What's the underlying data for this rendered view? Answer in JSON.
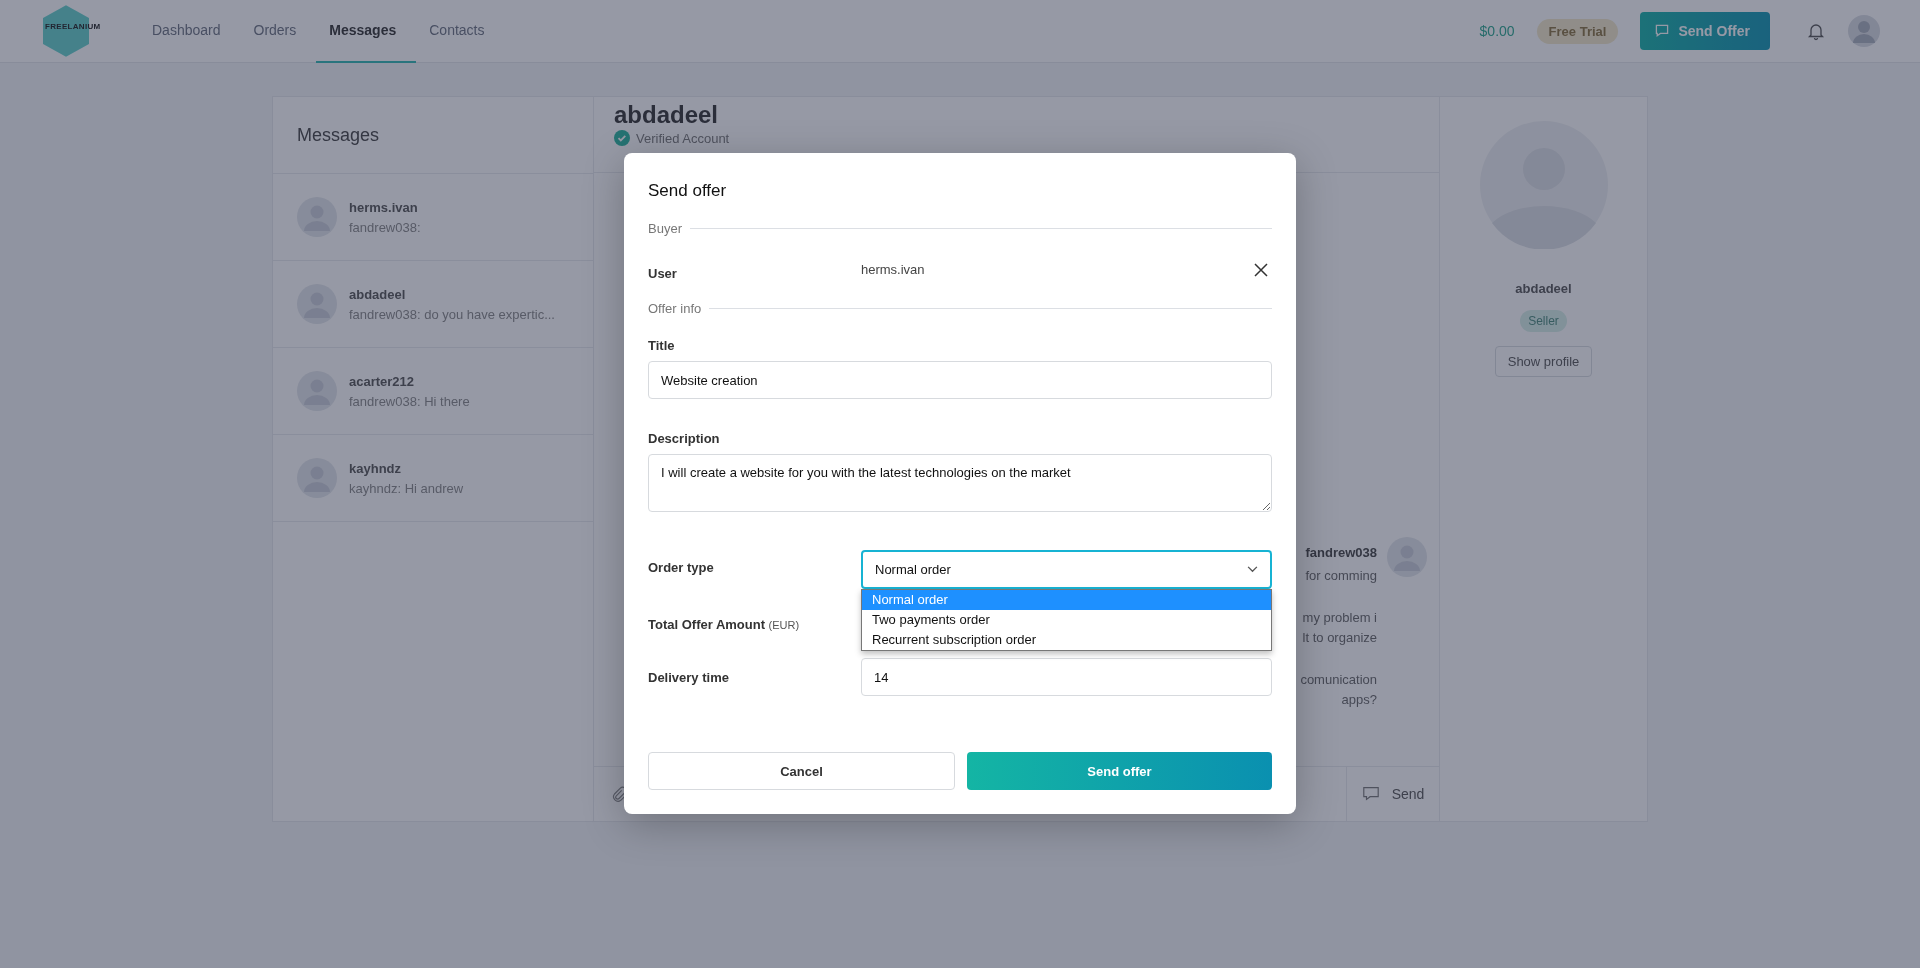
{
  "nav": {
    "logo": "FREELANIUM",
    "links": [
      {
        "label": "Dashboard",
        "selected": false
      },
      {
        "label": "Orders",
        "selected": false
      },
      {
        "label": "Messages",
        "selected": true
      },
      {
        "label": "Contacts",
        "selected": false
      }
    ],
    "balance": "$0.00",
    "plan": "Free Trial",
    "send_offer": "Send Offer"
  },
  "messages": {
    "title": "Messages",
    "conversations": [
      {
        "name": "herms.ivan",
        "preview": "fandrew038:"
      },
      {
        "name": "abdadeel",
        "preview": "fandrew038: do you have expertic..."
      },
      {
        "name": "acarter212",
        "preview": "fandrew038: Hi there"
      },
      {
        "name": "kayhndz",
        "preview": "kayhndz: Hi andrew"
      }
    ]
  },
  "chat": {
    "contact": "abdadeel",
    "verified": "Verified Account",
    "author": "fandrew038",
    "fragments": [
      [
        "for comming"
      ],
      [
        "my problem i",
        "lt to organize"
      ],
      [
        "comunication",
        "apps?"
      ]
    ],
    "send": "Send"
  },
  "profile": {
    "name": "abdadeel",
    "role": "Seller",
    "show_profile": "Show profile"
  },
  "modal": {
    "title": "Send offer",
    "buyer_section": "Buyer",
    "user_label": "User",
    "user_value": "herms.ivan",
    "offer_section": "Offer info",
    "title_field": {
      "label": "Title",
      "value": "Website creation"
    },
    "description_field": {
      "label": "Description",
      "value": "I will create a website for you with the latest technologies on the market"
    },
    "order_type": {
      "label": "Order type",
      "value": "Normal order",
      "expanded": true,
      "options": [
        {
          "label": "Normal order",
          "selected": true
        },
        {
          "label": "Two payments order",
          "selected": false
        },
        {
          "label": "Recurrent subscription order",
          "selected": false
        }
      ]
    },
    "amount": {
      "label": "Total Offer Amount",
      "unit": "(EUR)"
    },
    "delivery": {
      "label": "Delivery time",
      "value": "14"
    },
    "cancel": "Cancel",
    "submit": "Send offer"
  }
}
